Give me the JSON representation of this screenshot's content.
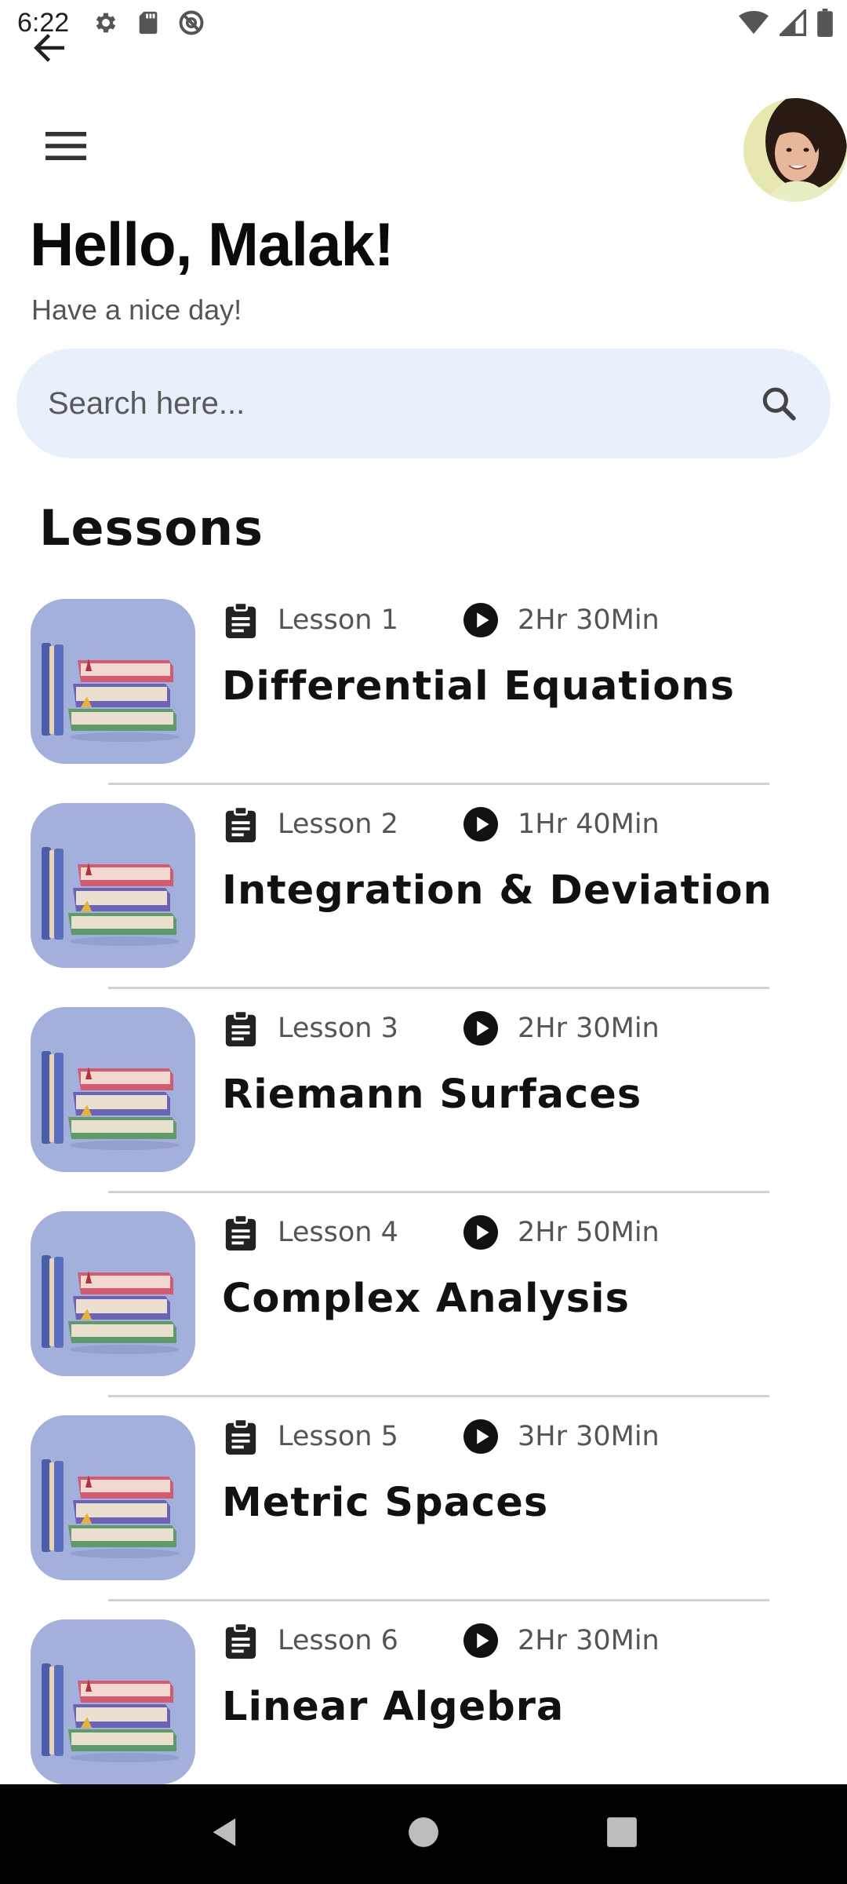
{
  "status_bar": {
    "time": "6:22",
    "left_icons": [
      "settings-icon",
      "sd-card-icon",
      "no-location-icon"
    ],
    "right_icons": [
      "wifi-icon",
      "signal-icon",
      "battery-icon"
    ]
  },
  "header": {
    "greeting": "Hello, Malak!",
    "subtitle": "Have a nice day!"
  },
  "search": {
    "placeholder": "Search here..."
  },
  "section": {
    "title": "Lessons"
  },
  "lessons": [
    {
      "number": "Lesson 1",
      "duration": "2Hr 30Min",
      "title": "Differential Equations"
    },
    {
      "number": "Lesson 2",
      "duration": "1Hr 40Min",
      "title": "Integration & Deviation"
    },
    {
      "number": "Lesson 3",
      "duration": "2Hr 30Min",
      "title": "Riemann Surfaces"
    },
    {
      "number": "Lesson 4",
      "duration": "2Hr 50Min",
      "title": "Complex Analysis"
    },
    {
      "number": "Lesson 5",
      "duration": "3Hr 30Min",
      "title": "Metric Spaces"
    },
    {
      "number": "Lesson 6",
      "duration": "2Hr 30Min",
      "title": "Linear Algebra"
    }
  ],
  "colors": {
    "search_bg": "#e8f0fc",
    "thumb_bg": "#a3b0dc",
    "nav_bg": "#000000"
  }
}
